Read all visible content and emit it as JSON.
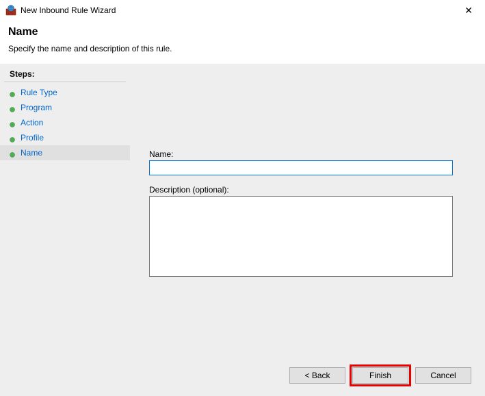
{
  "titlebar": {
    "title": "New Inbound Rule Wizard"
  },
  "header": {
    "title": "Name",
    "subtitle": "Specify the name and description of this rule."
  },
  "sidebar": {
    "heading": "Steps:",
    "items": [
      {
        "label": "Rule Type"
      },
      {
        "label": "Program"
      },
      {
        "label": "Action"
      },
      {
        "label": "Profile"
      },
      {
        "label": "Name"
      }
    ]
  },
  "form": {
    "name_label": "Name:",
    "name_value": "",
    "desc_label": "Description (optional):",
    "desc_value": ""
  },
  "buttons": {
    "back": "< Back",
    "finish": "Finish",
    "cancel": "Cancel"
  }
}
